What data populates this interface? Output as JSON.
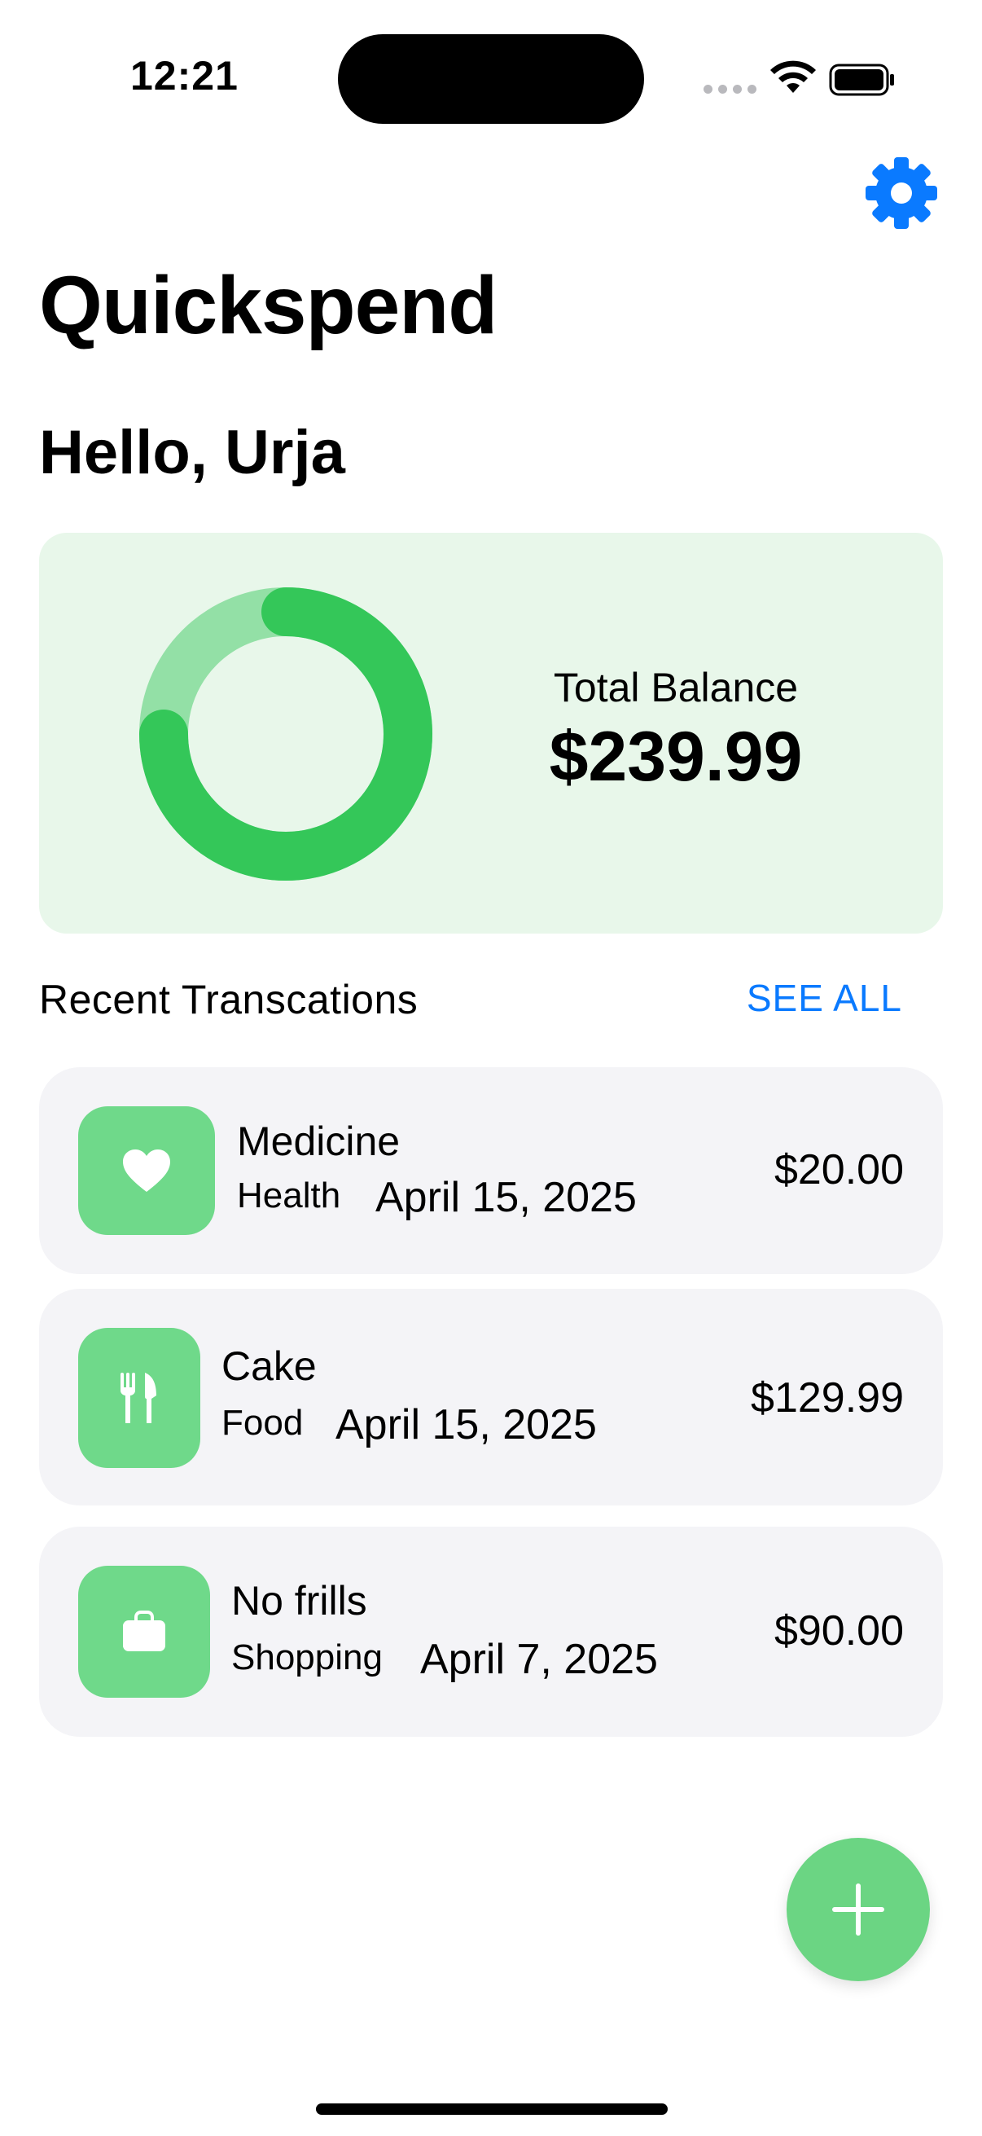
{
  "status_bar": {
    "time": "12:21"
  },
  "header": {
    "title": "Quickspend",
    "greeting": "Hello, Urja",
    "settings_icon": "gear-icon"
  },
  "balance": {
    "label": "Total Balance",
    "amount": "$239.99"
  },
  "recent": {
    "title": "Recent Transcations",
    "see_all_label": "SEE ALL"
  },
  "transactions": [
    {
      "name": "Medicine",
      "category": "Health",
      "date": "April 15, 2025",
      "amount": "$20.00",
      "icon": "heart-icon"
    },
    {
      "name": "Cake",
      "category": "Food",
      "date": "April 15, 2025",
      "amount": "$129.99",
      "icon": "fork-knife-icon"
    },
    {
      "name": "No frills",
      "category": "Shopping",
      "date": "April 7, 2025",
      "amount": "$90.00",
      "icon": "shopping-bag-icon"
    }
  ],
  "colors": {
    "accent_blue": "#0a7aff",
    "green_primary": "#34c759",
    "green_light": "#93e0a6",
    "card_background": "#e8f7ea",
    "icon_background": "#6fd98a"
  },
  "fab": {
    "icon": "plus-icon"
  }
}
